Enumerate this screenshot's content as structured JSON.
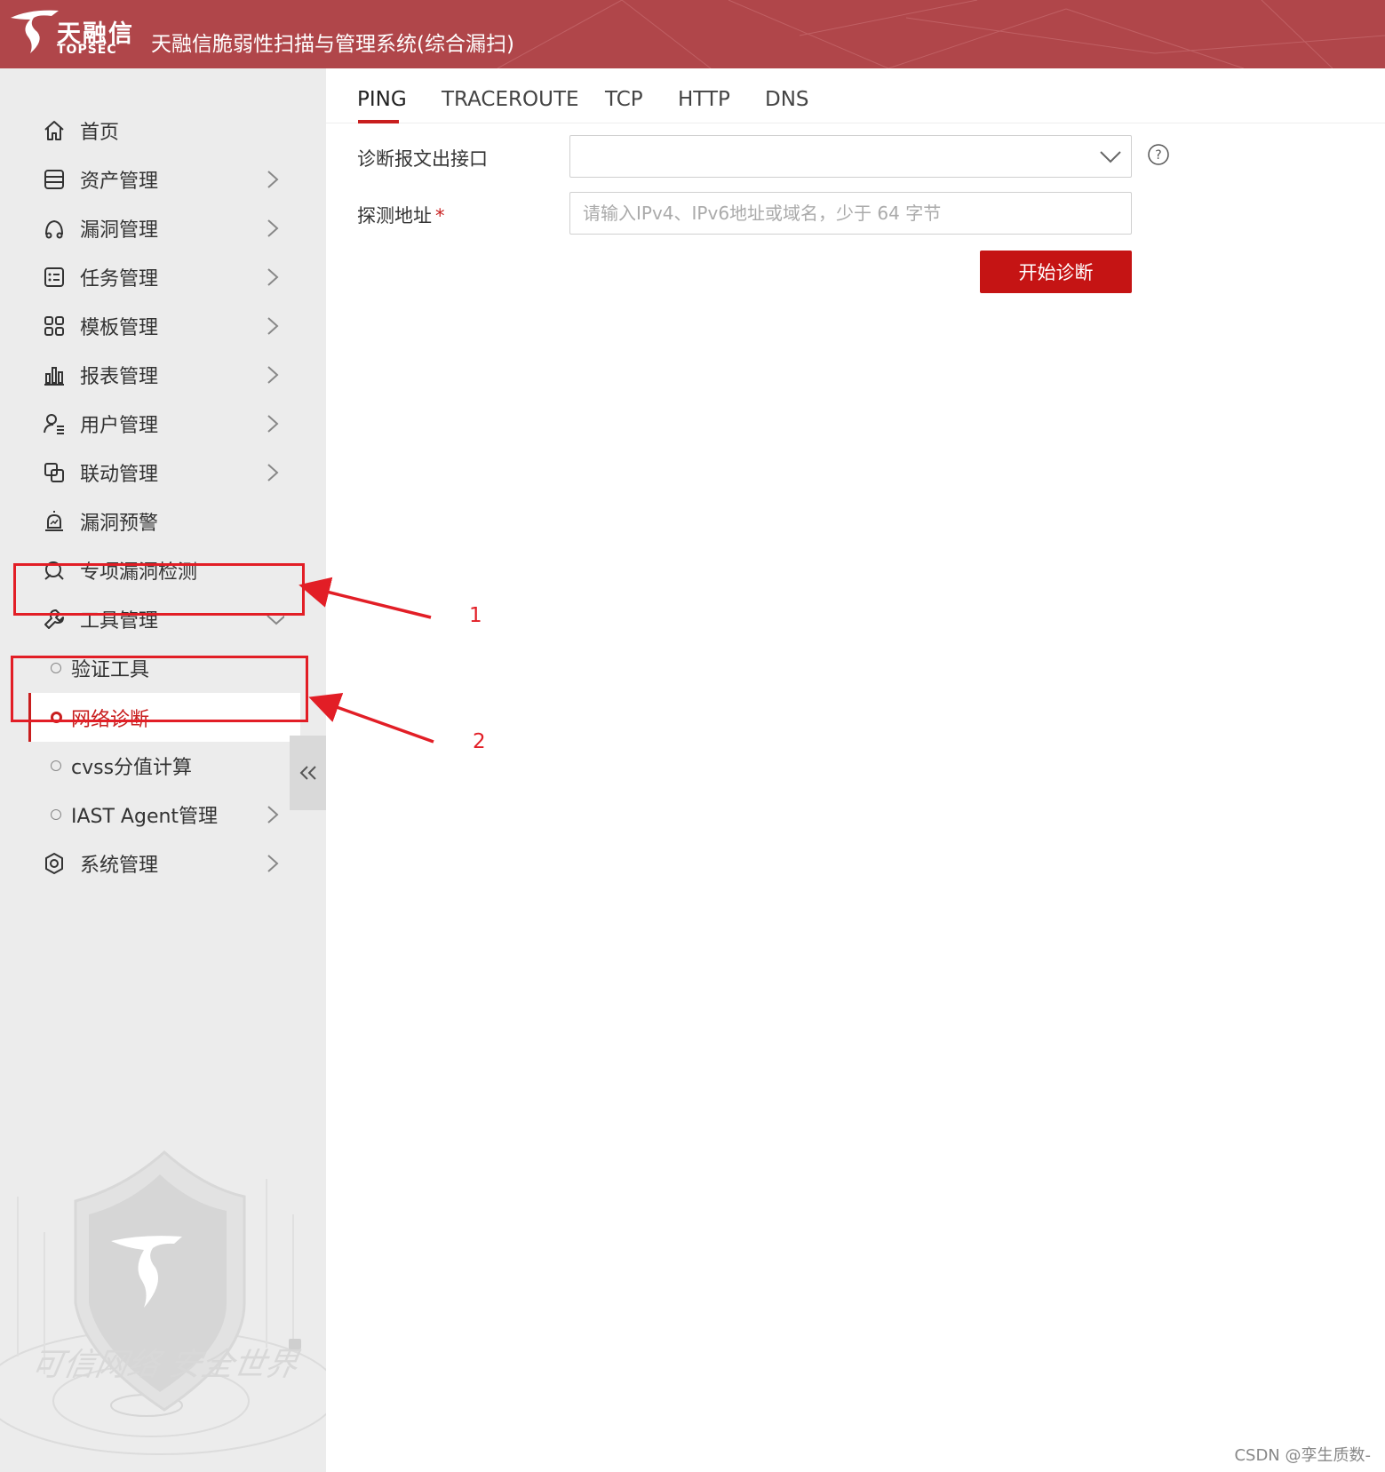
{
  "header": {
    "logo_cn": "天融信",
    "logo_en": "TOPSEC",
    "title": "天融信脆弱性扫描与管理系统(综合漏扫)",
    "bg_color": "#b0464a"
  },
  "sidebar": {
    "items": [
      {
        "label": "首页",
        "icon": "home-icon"
      },
      {
        "label": "资产管理",
        "icon": "database-icon"
      },
      {
        "label": "漏洞管理",
        "icon": "bug-icon"
      },
      {
        "label": "任务管理",
        "icon": "task-list-icon"
      },
      {
        "label": "模板管理",
        "icon": "grid-icon"
      },
      {
        "label": "报表管理",
        "icon": "bar-chart-icon"
      },
      {
        "label": "用户管理",
        "icon": "user-icon"
      },
      {
        "label": "联动管理",
        "icon": "link-icon"
      },
      {
        "label": "漏洞预警",
        "icon": "alarm-icon"
      },
      {
        "label": "专项漏洞检测",
        "icon": "search-icon"
      },
      {
        "label": "工具管理",
        "icon": "wrench-icon"
      },
      {
        "label": "系统管理",
        "icon": "settings-icon"
      }
    ],
    "sub_items": [
      {
        "label": "验证工具"
      },
      {
        "label": "网络诊断"
      },
      {
        "label": "cvss分值计算"
      },
      {
        "label": "IAST Agent管理"
      }
    ],
    "watermark_text": "可信网络 安全世界",
    "collapse_icon": "double-chevron-left-icon"
  },
  "main": {
    "tabs": [
      {
        "label": "PING"
      },
      {
        "label": "TRACEROUTE"
      },
      {
        "label": "TCP"
      },
      {
        "label": "HTTP"
      },
      {
        "label": "DNS"
      }
    ],
    "form": {
      "interface_label": "诊断报文出接口",
      "interface_value": "",
      "address_label": "探测地址",
      "required_mark": "*",
      "address_placeholder": "请输入IPv4、IPv6地址或域名，少于 64 字节",
      "address_value": "",
      "submit_label": "开始诊断"
    },
    "accent_color": "#c81e1e"
  },
  "annotations": {
    "label_1": "1",
    "label_2": "2"
  },
  "credit": "CSDN @孪生质数-"
}
